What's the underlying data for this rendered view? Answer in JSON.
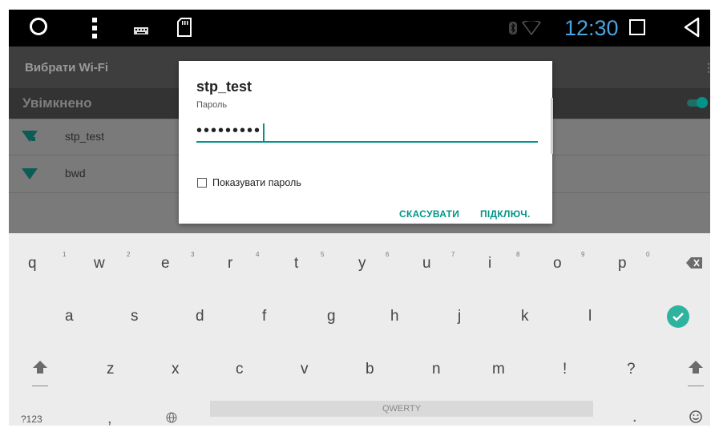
{
  "statusbar": {
    "time": "12:30",
    "icons": [
      "circle-home-icon",
      "more-vert-icon",
      "keyboard-icon",
      "sd-card-icon",
      "bluetooth-icon",
      "wifi-status-icon",
      "square-recent-icon",
      "back-triangle-icon"
    ]
  },
  "wifi": {
    "title": "Вибрати Wi-Fi",
    "status_label": "Увімкнено",
    "networks": [
      "stp_test",
      "bwd"
    ]
  },
  "dialog": {
    "title": "stp_test",
    "password_label": "Пароль",
    "password_value": "•••••••••",
    "show_password_label": "Показувати пароль",
    "cancel_label": "СКАСУВАТИ",
    "connect_label": "ПІДКЛЮЧ."
  },
  "keyboard": {
    "row1": [
      "q",
      "w",
      "e",
      "r",
      "t",
      "y",
      "u",
      "i",
      "o",
      "p"
    ],
    "row1_hints": [
      "1",
      "2",
      "3",
      "4",
      "5",
      "6",
      "7",
      "8",
      "9",
      "0"
    ],
    "row2": [
      "a",
      "s",
      "d",
      "f",
      "g",
      "h",
      "j",
      "k",
      "l"
    ],
    "row3": [
      "z",
      "x",
      "c",
      "v",
      "b",
      "n",
      "m",
      "!",
      "?"
    ],
    "symbols_key": "?123",
    "comma_key": ",",
    "period_key": ".",
    "space_label": "QWERTY",
    "accent_color": "#009587"
  }
}
